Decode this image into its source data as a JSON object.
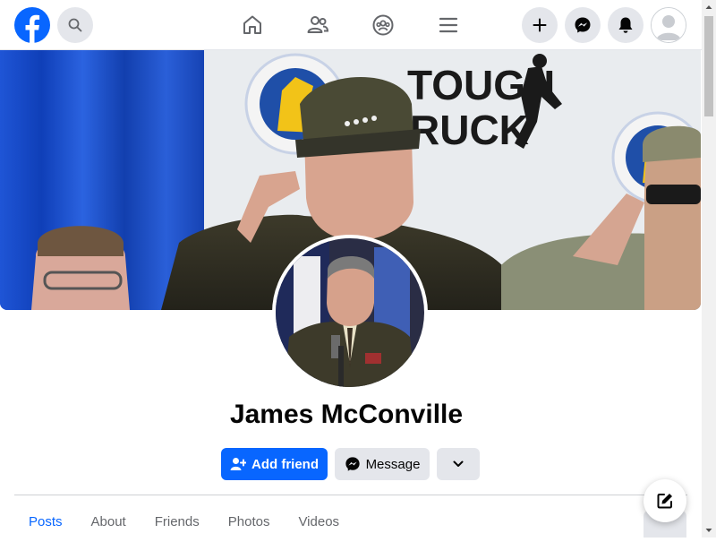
{
  "app": {
    "brand_color": "#0866ff"
  },
  "profile": {
    "name": "James McConville"
  },
  "actions": {
    "add_friend": "Add friend",
    "message": "Message"
  },
  "tabs": [
    {
      "label": "Posts",
      "active": true
    },
    {
      "label": "About",
      "active": false
    },
    {
      "label": "Friends",
      "active": false
    },
    {
      "label": "Photos",
      "active": false
    },
    {
      "label": "Videos",
      "active": false
    }
  ],
  "cover": {
    "banner_text_1": "TOUGH",
    "banner_text_2": "RUCK"
  },
  "icons": {
    "logo": "facebook-logo",
    "search": "search-icon",
    "home": "home-icon",
    "friends": "friends-icon",
    "groups": "groups-icon",
    "menu": "menu-icon",
    "create": "plus-icon",
    "messenger": "messenger-icon",
    "notifications": "bell-icon",
    "compose": "compose-icon"
  }
}
